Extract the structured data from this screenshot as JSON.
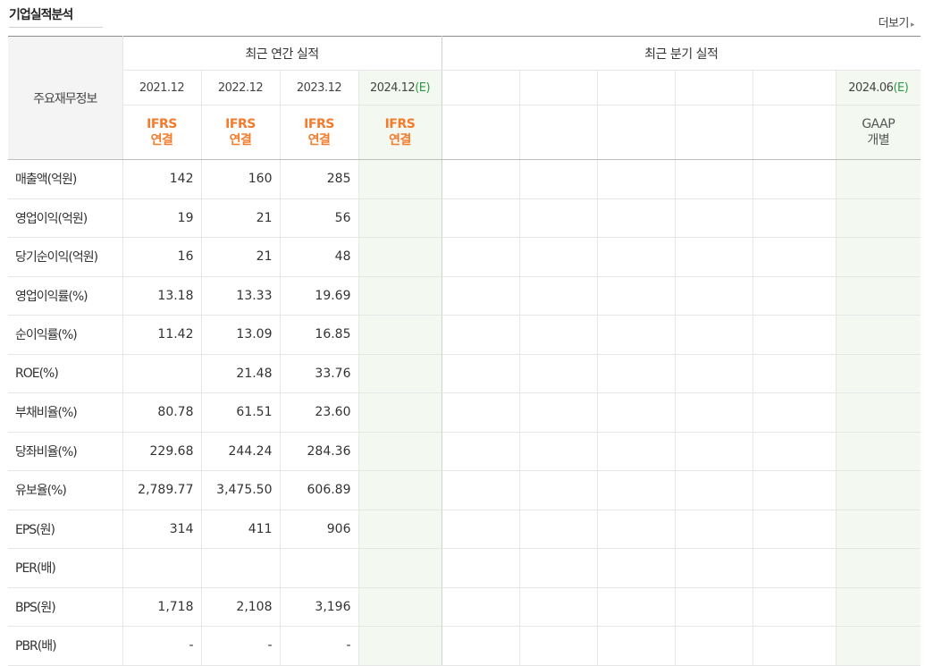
{
  "header": {
    "title": "기업실적분석",
    "more_label": "더보기"
  },
  "table": {
    "corner_label": "주요재무정보",
    "annual_group_label": "최근 연간 실적",
    "quarter_group_label": "최근 분기 실적",
    "annual_periods": [
      {
        "date": "2021.12",
        "est": "",
        "std1": "IFRS",
        "std2": "연결"
      },
      {
        "date": "2022.12",
        "est": "",
        "std1": "IFRS",
        "std2": "연결"
      },
      {
        "date": "2023.12",
        "est": "",
        "std1": "IFRS",
        "std2": "연결"
      },
      {
        "date": "2024.12",
        "est": "(E)",
        "std1": "IFRS",
        "std2": "연결"
      }
    ],
    "quarter_periods": [
      {
        "date": "",
        "est": "",
        "std1": "",
        "std2": ""
      },
      {
        "date": "",
        "est": "",
        "std1": "",
        "std2": ""
      },
      {
        "date": "",
        "est": "",
        "std1": "",
        "std2": ""
      },
      {
        "date": "",
        "est": "",
        "std1": "",
        "std2": ""
      },
      {
        "date": "",
        "est": "",
        "std1": "",
        "std2": ""
      },
      {
        "date": "2024.06",
        "est": "(E)",
        "std1": "GAAP",
        "std2": "개별"
      }
    ],
    "rows": [
      {
        "label": "매출액(억원)",
        "values": [
          "142",
          "160",
          "285",
          ""
        ]
      },
      {
        "label": "영업이익(억원)",
        "values": [
          "19",
          "21",
          "56",
          ""
        ]
      },
      {
        "label": "당기순이익(억원)",
        "values": [
          "16",
          "21",
          "48",
          ""
        ]
      },
      {
        "label": "영업이익률(%)",
        "values": [
          "13.18",
          "13.33",
          "19.69",
          ""
        ]
      },
      {
        "label": "순이익률(%)",
        "values": [
          "11.42",
          "13.09",
          "16.85",
          ""
        ]
      },
      {
        "label": "ROE(%)",
        "values": [
          "",
          "21.48",
          "33.76",
          ""
        ]
      },
      {
        "label": "부채비율(%)",
        "values": [
          "80.78",
          "61.51",
          "23.60",
          ""
        ]
      },
      {
        "label": "당좌비율(%)",
        "values": [
          "229.68",
          "244.24",
          "284.36",
          ""
        ]
      },
      {
        "label": "유보율(%)",
        "values": [
          "2,789.77",
          "3,475.50",
          "606.89",
          ""
        ]
      },
      {
        "label": "EPS(원)",
        "values": [
          "314",
          "411",
          "906",
          ""
        ]
      },
      {
        "label": "PER(배)",
        "values": [
          "",
          "",
          "",
          ""
        ]
      },
      {
        "label": "BPS(원)",
        "values": [
          "1,718",
          "2,108",
          "3,196",
          ""
        ]
      },
      {
        "label": "PBR(배)",
        "values": [
          "-",
          "-",
          "-",
          ""
        ]
      }
    ]
  },
  "colors": {
    "ifrs": "#f47a2c",
    "estimate_text": "#2d9a46",
    "estimate_bg": "#f3f9f1",
    "header_bg": "#f4f4f4"
  }
}
